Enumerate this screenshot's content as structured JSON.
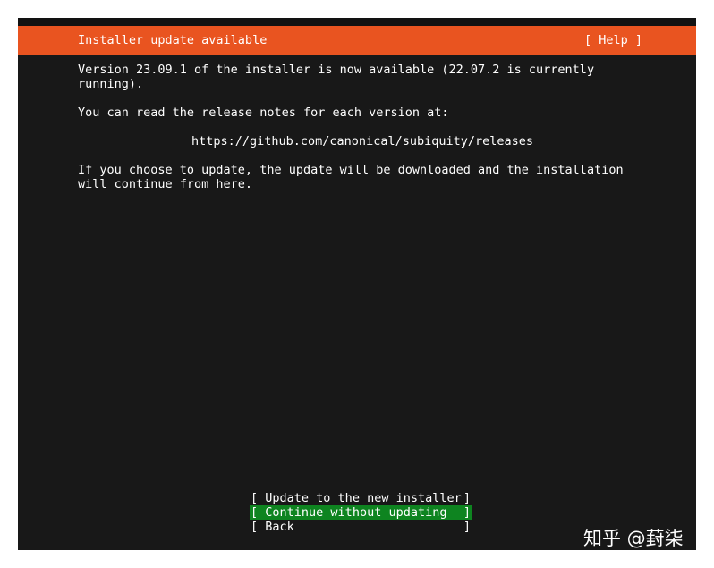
{
  "header": {
    "title": "Installer update available",
    "help_label": "[ Help ]"
  },
  "body": {
    "paragraph1_line1": "Version 23.09.1 of the installer is now available (22.07.2 is currently",
    "paragraph1_line2": "running).",
    "paragraph2": "You can read the release notes for each version at:",
    "url": "https://github.com/canonical/subiquity/releases",
    "paragraph3_line1": "If you choose to update, the update will be downloaded and the installation",
    "paragraph3_line2": "will continue from here."
  },
  "menu": {
    "items": [
      {
        "label": "Update to the new installer",
        "selected": false
      },
      {
        "label": "Continue without updating",
        "selected": true
      },
      {
        "label": "Back",
        "selected": false
      }
    ],
    "bracket_open": "[",
    "bracket_close": "]"
  },
  "watermark": {
    "text": "知乎 @葑柒"
  },
  "colors": {
    "titlebar": "#e95420",
    "selection": "#0e8420",
    "background": "#181818",
    "text": "#ffffff"
  }
}
